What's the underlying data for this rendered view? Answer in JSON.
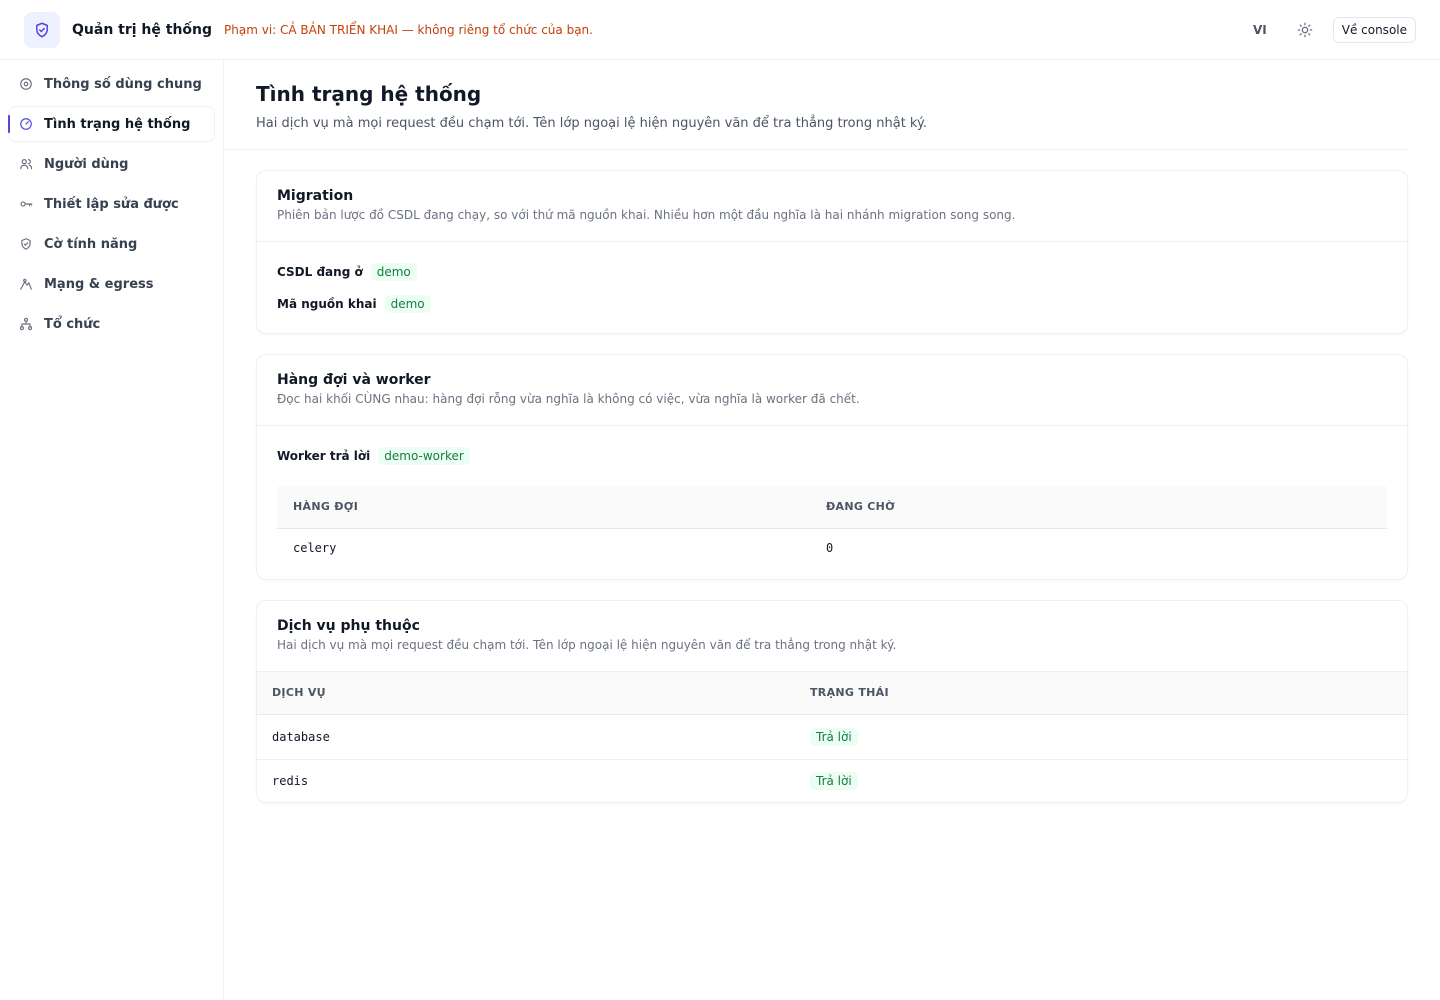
{
  "header": {
    "title": "Quản trị hệ thống",
    "scope_text": "Phạm vi: CẢ BẢN TRIỂN KHAI — không riêng tổ chức của bạn.",
    "language": "VI",
    "theme_icon": "sun-icon",
    "console_button": "Về console",
    "accent_color": "#4f46e5",
    "scope_color": "#c2410c"
  },
  "sidebar": {
    "items": [
      {
        "label": "Thông số dùng chung",
        "icon": "settings-icon"
      },
      {
        "label": "Tình trạng hệ thống",
        "icon": "gauge-icon",
        "active": true
      },
      {
        "label": "Người dùng",
        "icon": "users-icon"
      },
      {
        "label": "Thiết lập sửa được",
        "icon": "key-icon"
      },
      {
        "label": "Cờ tính năng",
        "icon": "shield-icon"
      },
      {
        "label": "Mạng & egress",
        "icon": "network-icon"
      },
      {
        "label": "Tổ chức",
        "icon": "org-tree-icon"
      }
    ]
  },
  "page": {
    "title": "Tình trạng hệ thống",
    "subtitle": "Hai dịch vụ mà mọi request đều chạm tới. Tên lớp ngoại lệ hiện nguyên văn để tra thẳng trong nhật ký."
  },
  "migration": {
    "title": "Migration",
    "subtitle": "Phiên bản lược đồ CSDL đang chạy, so với thứ mã nguồn khai. Nhiều hơn một đầu nghĩa là hai nhánh migration song song.",
    "db_label": "CSDL đang ở",
    "db_value": "demo",
    "code_label": "Mã nguồn khai",
    "code_value": "demo"
  },
  "queues": {
    "title": "Hàng đợi và worker",
    "subtitle": "Đọc hai khối CÙNG nhau: hàng đợi rỗng vừa nghĩa là không có việc, vừa nghĩa là worker đã chết.",
    "worker_label": "Worker trả lời",
    "worker_value": "demo-worker",
    "columns": [
      "HÀNG ĐỢI",
      "ĐANG CHỜ"
    ],
    "rows": [
      {
        "queue": "celery",
        "pending": "0"
      }
    ]
  },
  "dependencies": {
    "title": "Dịch vụ phụ thuộc",
    "subtitle": "Hai dịch vụ mà mọi request đều chạm tới. Tên lớp ngoại lệ hiện nguyên văn để tra thẳng trong nhật ký.",
    "columns": [
      "DỊCH VỤ",
      "TRẠNG THÁI"
    ],
    "rows": [
      {
        "service": "database",
        "status": "Trả lời"
      },
      {
        "service": "redis",
        "status": "Trả lời"
      }
    ],
    "status_color": "#15803d"
  }
}
